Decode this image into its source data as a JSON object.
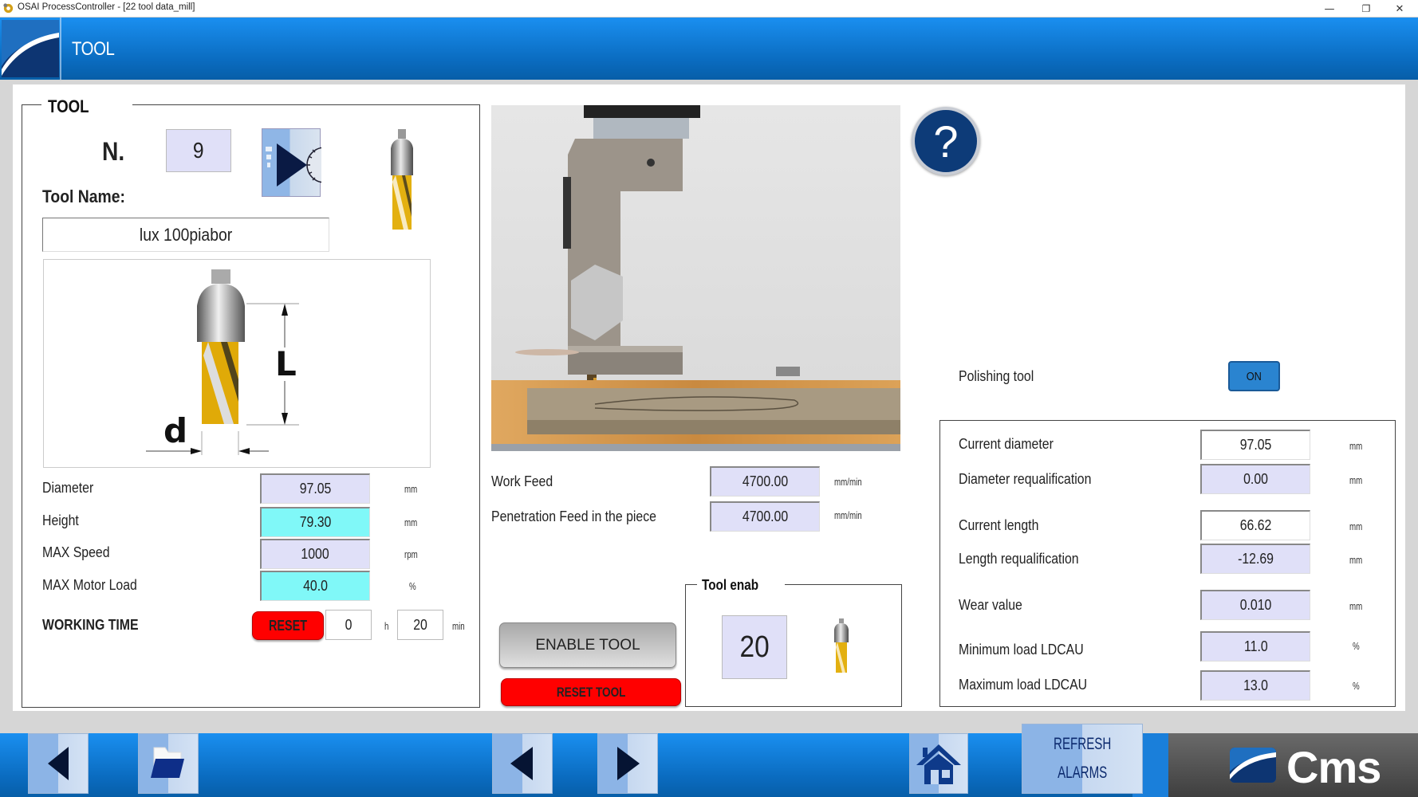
{
  "window": {
    "title": "OSAI ProcessController - [22 tool data_mill]",
    "controls": {
      "minimize": "—",
      "restore": "❐",
      "close": "✕"
    }
  },
  "header": {
    "title": "TOOL"
  },
  "tool_group": {
    "legend": "TOOL",
    "number_label": "N.",
    "number_value": "9",
    "tool_name_label": "Tool Name:",
    "tool_name_value": "lux 100piabor",
    "diagram_labels": {
      "length": "L",
      "diameter": "d"
    },
    "params": [
      {
        "label": "Diameter",
        "value": "97.05",
        "unit": "mm",
        "color": "lavender"
      },
      {
        "label": "Height",
        "value": "79.30",
        "unit": "mm",
        "color": "cyan"
      },
      {
        "label": "MAX Speed",
        "value": "1000",
        "unit": "rpm",
        "color": "lavender"
      },
      {
        "label": "MAX Motor Load",
        "value": "40.0",
        "unit": "%",
        "color": "cyan"
      }
    ],
    "working_time": {
      "label": "WORKING TIME",
      "reset_label": "RESET",
      "hours": "0",
      "hours_unit": "h",
      "minutes": "20",
      "minutes_unit": "min"
    }
  },
  "feeds": [
    {
      "label": "Work Feed",
      "value": "4700.00",
      "unit": "mm/min"
    },
    {
      "label": "Penetration Feed in the piece",
      "value": "4700.00",
      "unit": "mm/min"
    }
  ],
  "actions": {
    "enable_tool": "ENABLE TOOL",
    "reset_tool": "RESET TOOL"
  },
  "tool_enab": {
    "legend": "Tool enab",
    "value": "20"
  },
  "help": {
    "glyph": "?"
  },
  "polishing": {
    "label": "Polishing tool",
    "toggle": "ON"
  },
  "measurements": [
    {
      "label": "Current diameter",
      "value": "97.05",
      "unit": "mm",
      "color": "white"
    },
    {
      "label": "Diameter requalification",
      "value": "0.00",
      "unit": "mm",
      "color": "lavender"
    },
    {
      "label": "Current length",
      "value": "66.62",
      "unit": "mm",
      "color": "white"
    },
    {
      "label": "Length requalification",
      "value": "-12.69",
      "unit": "mm",
      "color": "lavender"
    },
    {
      "label": "Wear value",
      "value": "0.010",
      "unit": "mm",
      "color": "lavender"
    },
    {
      "label": "Minimum load LDCAU",
      "value": "11.0",
      "unit": "%",
      "color": "lavender"
    },
    {
      "label": "Maximum load LDCAU",
      "value": "13.0",
      "unit": "%",
      "color": "lavender"
    }
  ],
  "bottom_nav": {
    "back": "back-arrow-icon",
    "open": "folder-open-icon",
    "prev": "previous-arrow-icon",
    "next": "next-arrow-icon",
    "home": "home-icon",
    "refresh_alarms_line1": "REFRESH",
    "refresh_alarms_line2": "ALARMS",
    "brand": "Cms"
  },
  "colors": {
    "header_blue": "#1a8ff0",
    "field_lavender": "#e0e0f8",
    "field_cyan": "#80f8f8",
    "reset_red": "#ff0000",
    "toggle_on": "#2a84d0",
    "help_navy": "#0d3b78"
  }
}
